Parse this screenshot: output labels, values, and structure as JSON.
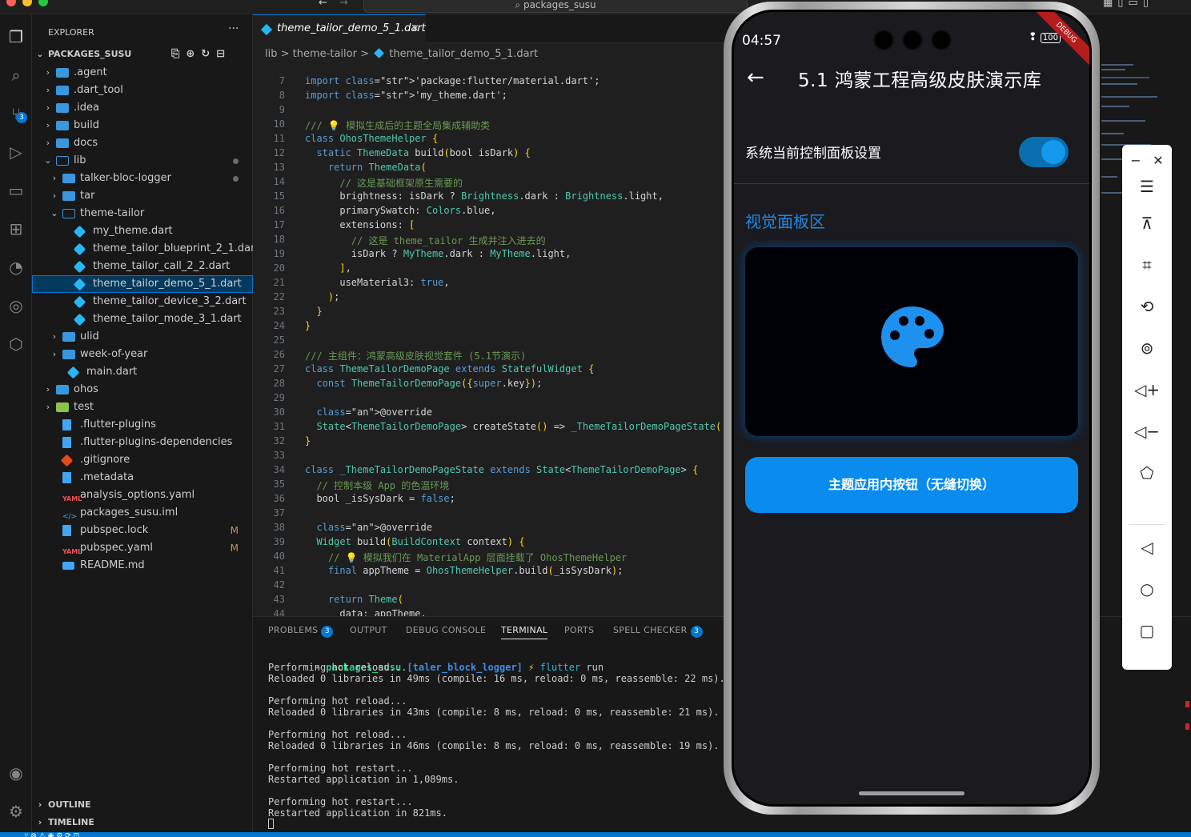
{
  "window": {
    "search_text": "packages_susu"
  },
  "activity_bar": {
    "scm_badge": "3"
  },
  "explorer": {
    "title": "EXPLORER",
    "more": "···",
    "root": "PACKAGES_SUSU",
    "items": [
      {
        "label": ".agent"
      },
      {
        "label": ".dart_tool"
      },
      {
        "label": ".idea"
      },
      {
        "label": "build"
      },
      {
        "label": "docs"
      },
      {
        "label": "lib"
      },
      {
        "label": "talker-bloc-logger"
      },
      {
        "label": "tar"
      },
      {
        "label": "theme-tailor"
      },
      {
        "label": "my_theme.dart"
      },
      {
        "label": "theme_tailor_blueprint_2_1.dart"
      },
      {
        "label": "theme_tailor_call_2_2.dart"
      },
      {
        "label": "theme_tailor_demo_5_1.dart"
      },
      {
        "label": "theme_tailor_device_3_2.dart"
      },
      {
        "label": "theme_tailor_mode_3_1.dart"
      },
      {
        "label": "ulid"
      },
      {
        "label": "week-of-year"
      },
      {
        "label": "main.dart"
      },
      {
        "label": "ohos"
      },
      {
        "label": "test"
      },
      {
        "label": ".flutter-plugins"
      },
      {
        "label": ".flutter-plugins-dependencies"
      },
      {
        "label": ".gitignore"
      },
      {
        "label": ".metadata"
      },
      {
        "label": "analysis_options.yaml"
      },
      {
        "label": "packages_susu.iml"
      },
      {
        "label": "pubspec.lock",
        "status": "M"
      },
      {
        "label": "pubspec.yaml",
        "status": "M"
      },
      {
        "label": "README.md"
      }
    ],
    "outline": "OUTLINE",
    "timeline": "TIMELINE"
  },
  "editor": {
    "tab_label": "theme_tailor_demo_5_1.dart",
    "tab_close": "×",
    "breadcrumb": [
      "lib",
      ">",
      "theme-tailor",
      ">",
      "theme_tailor_demo_5_1.dart"
    ],
    "line_numbers": [
      "7",
      "8",
      "9",
      "10",
      "11",
      "12",
      "13",
      "14",
      "15",
      "16",
      "17",
      "18",
      "19",
      "20",
      "21",
      "22",
      "23",
      "24",
      "25",
      "26",
      "27",
      "28",
      "29",
      "30",
      "31",
      "32",
      "33",
      "34",
      "35",
      "36",
      "37",
      "38",
      "39",
      "40",
      "41",
      "42",
      "43",
      "44"
    ],
    "lines": [
      "import 'package:flutter/material.dart';",
      "import 'my_theme.dart';",
      "",
      "/// 💡 模拟生成后的主题全局集成辅助类",
      "class OhosThemeHelper {",
      "  static ThemeData build(bool isDark) {",
      "    return ThemeData(",
      "      // 这是基础框架原生需要的",
      "      brightness: isDark ? Brightness.dark : Brightness.light,",
      "      primarySwatch: Colors.blue,",
      "      extensions: [",
      "        // 这是 theme_tailor 生成并注入进去的",
      "        isDark ? MyTheme.dark : MyTheme.light,",
      "      ],",
      "      useMaterial3: true,",
      "    );",
      "  }",
      "}",
      "",
      "/// 主组件：鸿蒙高级皮肤视觉套件 (5.1节演示)",
      "class ThemeTailorDemoPage extends StatefulWidget {",
      "  const ThemeTailorDemoPage({super.key});",
      "",
      "  @override",
      "  State<ThemeTailorDemoPage> createState() => _ThemeTailorDemoPageState(",
      "}",
      "",
      "class _ThemeTailorDemoPageState extends State<ThemeTailorDemoPage> {",
      "  // 控制本级 App 的色温环境",
      "  bool _isSysDark = false;",
      "",
      "  @override",
      "  Widget build(BuildContext context) {",
      "    // 💡 模拟我们在 MaterialApp 层面挂载了 OhosThemeHelper",
      "    final appTheme = OhosThemeHelper.build(_isSysDark);",
      "",
      "    return Theme(",
      "      data: appTheme,"
    ]
  },
  "panel": {
    "tabs": [
      {
        "label": "PROBLEMS",
        "badge": "3"
      },
      {
        "label": "OUTPUT"
      },
      {
        "label": "DEBUG CONSOLE"
      },
      {
        "label": "TERMINAL"
      },
      {
        "label": "PORTS"
      },
      {
        "label": "SPELL CHECKER",
        "badge": "3"
      }
    ],
    "prompt": {
      "dir": "packages_susu",
      "branch": "[taler_block_logger]",
      "bolt": "⚡",
      "cmd": "flutter",
      "arg": "run"
    },
    "terminal_lines": [
      "Performing hot reload...",
      "Reloaded 0 libraries in 49ms (compile: 16 ms, reload: 0 ms, reassemble: 22 ms).",
      "",
      "Performing hot reload...",
      "Reloaded 0 libraries in 43ms (compile: 8 ms, reload: 0 ms, reassemble: 21 ms).",
      "",
      "Performing hot reload...",
      "Reloaded 0 libraries in 46ms (compile: 8 ms, reload: 0 ms, reassemble: 19 ms).",
      "",
      "Performing hot restart...",
      "Restarted application in 1,089ms.",
      "",
      "Performing hot restart...",
      "Restarted application in 821ms."
    ]
  },
  "phone": {
    "time": "04:57",
    "battery": "100",
    "debug_ribbon": "DEBUG",
    "app_title": "5.1 鸿蒙工程高级皮肤演示库",
    "toggle_label": "系统当前控制面板设置",
    "toggle_on": true,
    "section_title": "视觉面板区",
    "button_label": "主题应用内按钮（无缝切换）",
    "accent": "#1e88e5"
  },
  "tools": [
    "minimize-icon",
    "close-icon",
    "menu-icon",
    "pin-icon",
    "crop-icon",
    "rotate-icon",
    "screenshot-icon",
    "volume-up-icon",
    "volume-down-icon",
    "shake-icon",
    "back-icon",
    "home-icon",
    "overview-icon"
  ]
}
